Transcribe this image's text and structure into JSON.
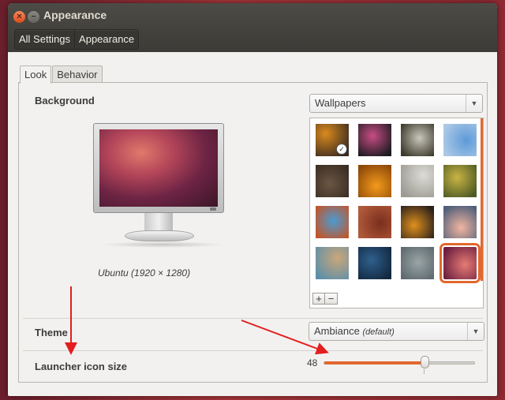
{
  "window": {
    "title": "Appearance"
  },
  "navbar": {
    "items": [
      "All Settings",
      "Appearance"
    ]
  },
  "tabs": [
    {
      "label": "Look",
      "active": true
    },
    {
      "label": "Behavior",
      "active": false
    }
  ],
  "background": {
    "label": "Background",
    "caption": "Ubuntu (1920 × 1280)",
    "source": "Wallpapers",
    "thumbnails": [
      {
        "name": "wallpaper-orange-circle",
        "colors": [
          "#d98a1d",
          "#3a2a20"
        ],
        "current": true
      },
      {
        "name": "wallpaper-hummingbird",
        "colors": [
          "#c84c84",
          "#1b1b20"
        ]
      },
      {
        "name": "wallpaper-white-flowers",
        "colors": [
          "#c9c6bd",
          "#3c3a2a"
        ]
      },
      {
        "name": "wallpaper-sky-flowers",
        "colors": [
          "#5d9ad8",
          "#aac8e6"
        ]
      },
      {
        "name": "wallpaper-brown-texture",
        "colors": [
          "#6b5642",
          "#3a2e24"
        ]
      },
      {
        "name": "wallpaper-orange-flower",
        "colors": [
          "#f39a1b",
          "#8e4a08"
        ]
      },
      {
        "name": "wallpaper-dandelion",
        "colors": [
          "#dcdcd6",
          "#9c9a92"
        ]
      },
      {
        "name": "wallpaper-green-bokeh",
        "colors": [
          "#c9b445",
          "#4e5a24"
        ]
      },
      {
        "name": "wallpaper-graffiti",
        "colors": [
          "#4a9bd2",
          "#c1562c"
        ]
      },
      {
        "name": "wallpaper-red-macro",
        "colors": [
          "#7a2e1d",
          "#b05a3a"
        ]
      },
      {
        "name": "wallpaper-orange-arc",
        "colors": [
          "#e0901e",
          "#2a201a"
        ]
      },
      {
        "name": "wallpaper-sunset-sky",
        "colors": [
          "#f2b5a0",
          "#52607a"
        ]
      },
      {
        "name": "wallpaper-rope",
        "colors": [
          "#caa77a",
          "#5e8fa8"
        ]
      },
      {
        "name": "wallpaper-blue-tiles",
        "colors": [
          "#2f5f8e",
          "#12283e"
        ]
      },
      {
        "name": "wallpaper-grey-mist",
        "colors": [
          "#9ba5a6",
          "#5f6b70"
        ]
      },
      {
        "name": "wallpaper-ubuntu-default",
        "colors": [
          "#e57b74",
          "#6d1f3f"
        ],
        "selected": true
      }
    ],
    "add_label": "+",
    "remove_label": "−"
  },
  "theme": {
    "label": "Theme",
    "value": "Ambiance",
    "note": "(default)"
  },
  "launcher": {
    "label": "Launcher icon size",
    "value": 48,
    "min": 16,
    "max": 64
  },
  "colors": {
    "accent": "#e2682f",
    "annotation": "#e41e1e"
  }
}
